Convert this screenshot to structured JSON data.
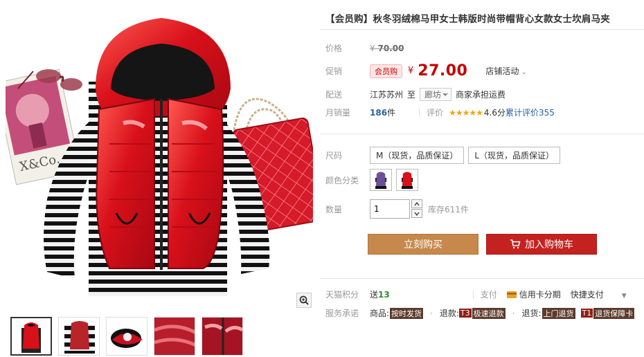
{
  "product": {
    "title": "【会员购】秋冬羽绒棉马甲女士韩版时尚带帽背心女款女士坎肩马夹"
  },
  "price": {
    "label": "价格",
    "currency": "¥",
    "original": "70.00"
  },
  "promo": {
    "label": "促销",
    "badge": "会员购",
    "currency": "¥",
    "price": "27.00",
    "shop_activity": "店铺活动"
  },
  "shipping": {
    "label": "配送",
    "from": "江苏苏州",
    "to_word": "至",
    "destination": "廊坊",
    "note": "商家承担运费"
  },
  "sales": {
    "label": "月销量",
    "count": "186",
    "unit": "件",
    "rating_label": "评价",
    "stars": "★★★★★",
    "score": "4.6分",
    "review_text": "累计评价355"
  },
  "size": {
    "label": "尺码",
    "options": [
      "M（现货，品质保证）",
      "L（现货，品质保证）"
    ]
  },
  "color": {
    "label": "颜色分类",
    "swatches": [
      "purple-vest",
      "red-vest"
    ]
  },
  "quantity": {
    "label": "数量",
    "value": "1",
    "stock": "库存611件"
  },
  "actions": {
    "buy_now": "立刻购买",
    "add_to_cart": "加入购物车"
  },
  "points": {
    "label": "天猫积分",
    "send": "送",
    "amount": "13",
    "pay_label": "支付",
    "credit_card": "信用卡分期",
    "quick_pay": "快捷支付"
  },
  "service": {
    "label": "服务承诺",
    "goods_prefix": "商品:",
    "goods_tag": "按时发货",
    "refund_prefix": "退款:",
    "refund_t3": "T3",
    "refund_tag": "极速退款",
    "return_prefix": "退货:",
    "return_tag": "上门退货",
    "t1": "T1",
    "t1_tag": "退货保障卡"
  },
  "colors": {
    "price_red": "#c40000",
    "buy_button": "#c7884c",
    "cart_button": "#c4221f",
    "link_blue": "#2460a8"
  }
}
